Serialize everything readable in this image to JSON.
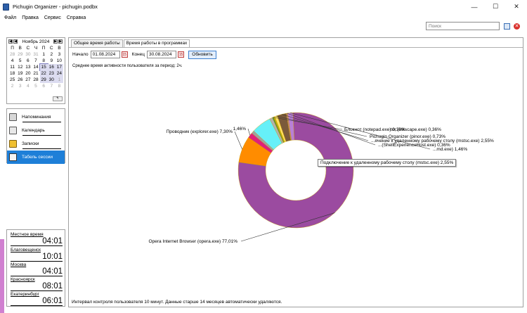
{
  "window": {
    "title": "Pichugin Organizer - pichugin.podbx",
    "minimize": "—",
    "maximize": "☐",
    "close": "✕"
  },
  "menu": [
    "Файл",
    "Правка",
    "Сервис",
    "Справка"
  ],
  "toolbar": {
    "search_placeholder": "Поиск"
  },
  "calendar": {
    "month": "Ноябрь 2024",
    "weekdays": [
      "П",
      "В",
      "С",
      "Ч",
      "П",
      "С",
      "В"
    ],
    "rows": [
      [
        "28",
        "29",
        "30",
        "31",
        "1",
        "2",
        "3"
      ],
      [
        "4",
        "5",
        "6",
        "7",
        "8",
        "9",
        "10"
      ],
      [
        "11",
        "12",
        "13",
        "14",
        "15",
        "16",
        "17"
      ],
      [
        "18",
        "19",
        "20",
        "21",
        "22",
        "23",
        "24"
      ],
      [
        "25",
        "26",
        "27",
        "28",
        "29",
        "30",
        "1"
      ],
      [
        "2",
        "3",
        "4",
        "5",
        "6",
        "7",
        "8"
      ]
    ]
  },
  "nav": {
    "items": [
      {
        "label": "Напоминания",
        "icon": "reminders-icon"
      },
      {
        "label": "Календарь",
        "icon": "calendar-icon"
      },
      {
        "label": "Записки",
        "icon": "notes-icon"
      },
      {
        "label": "Табель сессии",
        "icon": "session-table-icon"
      }
    ],
    "active": "Табель сессии"
  },
  "clocks": [
    {
      "city": "Местное время",
      "time": "04:01"
    },
    {
      "city": "Благовещенск",
      "time": "10:01"
    },
    {
      "city": "Москва",
      "time": "04:01"
    },
    {
      "city": "Красноярск",
      "time": "08:01"
    },
    {
      "city": "Екатеринбург",
      "time": "06:01"
    }
  ],
  "tabs": {
    "first": "Общее время работы",
    "second": "Время работы в программах"
  },
  "filter": {
    "start_label": "Начало",
    "start_value": "01.08.2024",
    "end_label": "Конец",
    "end_value": "30.08.2024",
    "refresh": "Обновить"
  },
  "summary": "Среднее время активности пользователя за период: 2ч.",
  "footer": "Интервал контроля пользователя 10 минут. Данные старше 14 месяцев автоматически удаляются.",
  "tooltip": "Подключение к удаленному рабочему столу (mstsc.exe) 2,55%",
  "chart_data": {
    "type": "pie",
    "donut": true,
    "series": [
      {
        "name": "Opera Internet Browser (opera.exe)",
        "value": 77.01,
        "color": "#9b4ba0",
        "label": "Opera Internet Browser (opera.exe) 77,01%"
      },
      {
        "name": "Проводник (explorer.exe)",
        "value": 7.3,
        "color": "#ff8c00",
        "label": "Проводник (explorer.exe) 7,30%"
      },
      {
        "name": "",
        "value": 1.46,
        "color": "#e0207a",
        "label": "1,46%"
      },
      {
        "name": "",
        "value": 0.8,
        "color": "#a0a0a0",
        "label": ""
      },
      {
        "name": "",
        "value": 5.5,
        "color": "#66f0f8",
        "label": ""
      },
      {
        "name": "",
        "value": 0.8,
        "color": "#b0b0b0",
        "label": ""
      },
      {
        "name": "Блокнот (notepad.exe)",
        "value": 0.36,
        "color": "#4b8c3a",
        "label": "Блокнот (notepad.exe) 0,36%"
      },
      {
        "name": "tor (inkscape.exe)",
        "value": 0.36,
        "color": "#c8b400",
        "label": "tor (inkscape.exe) 0,36%"
      },
      {
        "name": "Pichugin Organizer (pinor.exe)",
        "value": 0.73,
        "color": "#ffe066",
        "label": "Pichugin Organizer (pinor.exe) 0,73%"
      },
      {
        "name": "Подключение к удаленному рабочему столу (mstsc.exe)",
        "value": 2.55,
        "color": "#7b5a3a",
        "label": "...ячение к удаленному рабочему столу (mstsc.exe) 2,55%"
      },
      {
        "name": "",
        "value": 0.36,
        "color": "#c08080",
        "label": "...(ShellExperienceHost.exe) 0,36%"
      },
      {
        "name": "",
        "value": 1.46,
        "color": "#b87fd8",
        "label": "...md.exe) 1,46%"
      }
    ]
  }
}
